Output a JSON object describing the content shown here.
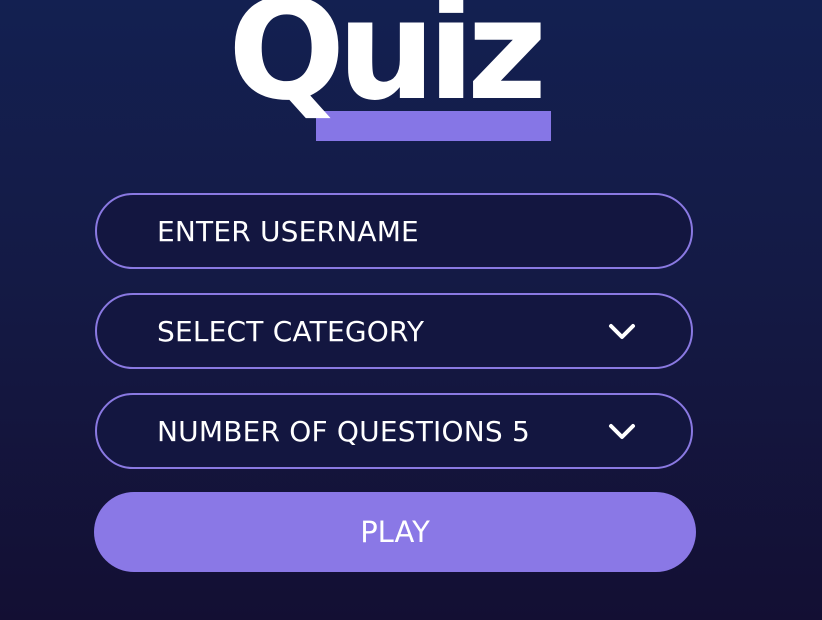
{
  "logo": {
    "text": "Quiz"
  },
  "form": {
    "username_placeholder": "ENTER USERNAME",
    "category_label": "SELECT CATEGORY",
    "questions_label": "NUMBER OF QUESTIONS",
    "questions_value": "5",
    "play_label": "PLAY"
  },
  "icons": {
    "category_chevron": "chevron-down-icon",
    "questions_chevron": "chevron-down-icon"
  },
  "colors": {
    "accent": "#8a78e6",
    "field_border": "#8a79e2",
    "background_top": "#132051",
    "background_bottom": "#130f33",
    "text": "#ffffff"
  }
}
